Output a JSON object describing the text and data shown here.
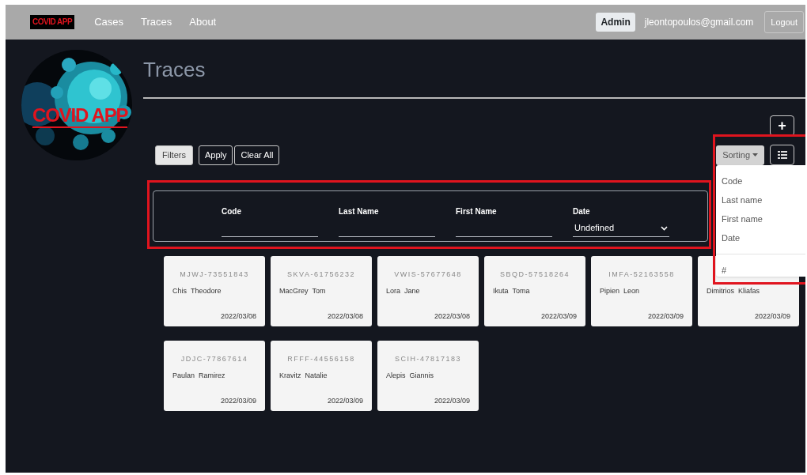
{
  "navbar": {
    "logo": "COVID APP",
    "links": [
      {
        "label": "Cases",
        "selected": false
      },
      {
        "label": "Traces",
        "selected": false
      },
      {
        "label": "About",
        "selected": false
      }
    ],
    "role_badge": "Admin",
    "user_email": "jleontopoulos@gmail.com",
    "logout": "Logout"
  },
  "sidebar": {
    "logo_text": "COVID APP"
  },
  "page_title": "Traces",
  "add_button": "+",
  "filter_buttons": [
    {
      "label": "Filters",
      "selected": true
    },
    {
      "label": "Apply",
      "selected": false
    },
    {
      "label": "Clear All",
      "selected": false
    }
  ],
  "sorting": {
    "label": "Sorting",
    "expanded": true,
    "options": [
      {
        "label": "Code"
      },
      {
        "label": "Last name"
      },
      {
        "label": "First name"
      },
      {
        "label": "Date"
      }
    ],
    "extra_option": "#"
  },
  "filters": [
    {
      "label": "Code",
      "kind": "text"
    },
    {
      "label": "Last Name",
      "kind": "text"
    },
    {
      "label": "First Name",
      "kind": "text"
    },
    {
      "label": "Date",
      "kind": "select",
      "value": "Undefined"
    }
  ],
  "traces": [
    {
      "code": "MJWJ-73551843",
      "last_name": "Chis",
      "first_name": "Theodore",
      "date": "2022/03/08"
    },
    {
      "code": "SKVA-61756232",
      "last_name": "MacGrey",
      "first_name": "Tom",
      "date": "2022/03/08"
    },
    {
      "code": "VWIS-57677648",
      "last_name": "Lora",
      "first_name": "Jane",
      "date": "2022/03/08"
    },
    {
      "code": "SBQD-57518264",
      "last_name": "Ikuta",
      "first_name": "Toma",
      "date": "2022/03/09"
    },
    {
      "code": "IMFA-52163558",
      "last_name": "Pipien",
      "first_name": "Leon",
      "date": "2022/03/09"
    },
    {
      "last_name": "Dimitrios",
      "first_name": "Kliafas",
      "date": "2022/03/09"
    },
    {
      "code": "JDJC-77867614",
      "last_name": "Paulan",
      "first_name": "Ramirez",
      "date": "2022/03/09"
    },
    {
      "code": "RFFF-44556158",
      "last_name": "Kravitz",
      "first_name": "Natalie",
      "date": "2022/03/09"
    },
    {
      "code": "SCIH-47817183",
      "last_name": "Alepis",
      "first_name": "Giannis",
      "date": "2022/03/09"
    }
  ]
}
